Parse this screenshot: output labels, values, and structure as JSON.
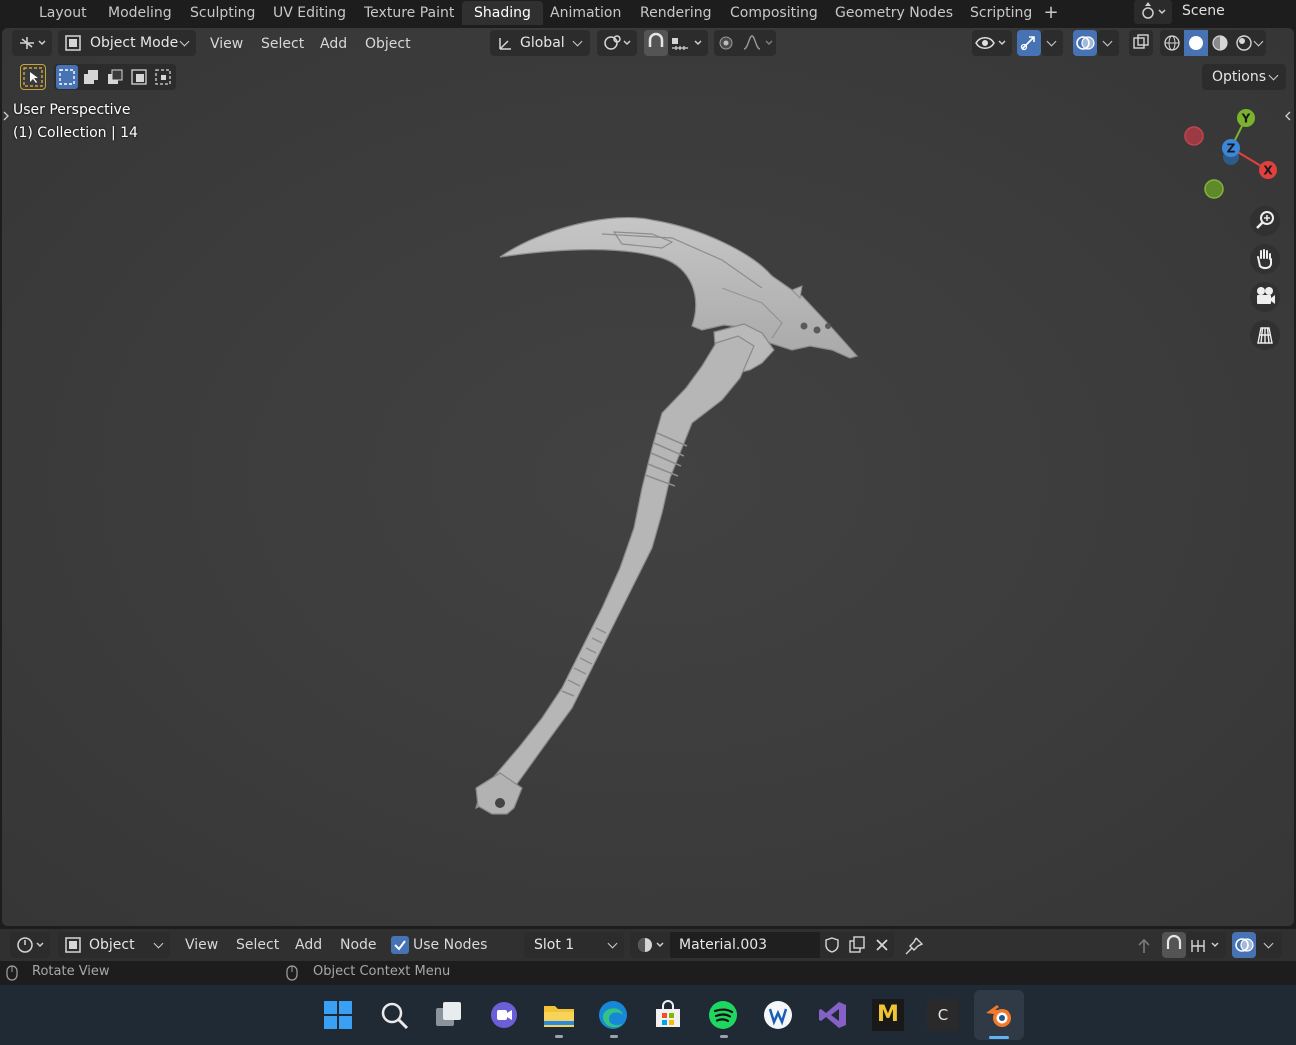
{
  "workspace_tabs": [
    "Layout",
    "Modeling",
    "Sculpting",
    "UV Editing",
    "Texture Paint",
    "Shading",
    "Animation",
    "Rendering",
    "Compositing",
    "Geometry Nodes",
    "Scripting"
  ],
  "active_tab": "Shading",
  "add_workspace_label": "+",
  "scene_name": "Scene",
  "viewport": {
    "mode_label": "Object Mode",
    "menus": [
      "View",
      "Select",
      "Add",
      "Object"
    ],
    "orientation_label": "Global",
    "options_label": "Options",
    "perspective_label": "User Perspective",
    "collection_label": "(1) Collection | 14",
    "gizmo_axes": {
      "x": "X",
      "y": "Y",
      "z": "Z"
    },
    "axis_colors": {
      "x": "#e0413f",
      "y": "#7bb32e",
      "z": "#3b87d9"
    }
  },
  "node_editor": {
    "object_type_label": "Object",
    "menus": [
      "View",
      "Select",
      "Add",
      "Node"
    ],
    "use_nodes_label": "Use Nodes",
    "use_nodes_checked": true,
    "slot_label": "Slot 1",
    "material_name": "Material.003"
  },
  "status_bar": {
    "left_hint": "Rotate View",
    "middle_hint": "Object Context Menu"
  },
  "taskbar": {
    "apps": [
      "windows-start",
      "search",
      "task-view",
      "teams-chat",
      "file-explorer",
      "edge",
      "microsoft-store",
      "spotify",
      "app-w",
      "visual-studio",
      "maya",
      "app-c",
      "blender"
    ],
    "c_label": "C",
    "m_label": "M"
  },
  "colors": {
    "accent_blue": "#4772b3",
    "active_tab_bg": "#303030",
    "viewport_bg": "#3d3d3d",
    "model_gray": "#b8b8b8"
  }
}
